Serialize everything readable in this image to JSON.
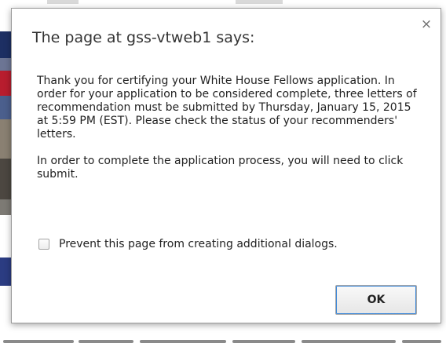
{
  "dialog": {
    "title": "The page at gss-vtweb1 says:",
    "close_glyph": "×",
    "message": {
      "paragraph_1": "Thank you for certifying your White House Fellows application. In order for your application to be considered complete, three letters of recommendation must be submitted by Thursday, January 15, 2015 at 5:59 PM (EST). Please check the status of your recommenders' letters.",
      "paragraph_2": "In order to complete the application process, you will need to click submit."
    },
    "checkbox": {
      "label": "Prevent this page from creating additional dialogs.",
      "checked": false
    },
    "ok_label": "OK"
  },
  "colors": {
    "dialog_border": "#9a9a9a",
    "focus_ring": "#3a86d8",
    "text": "#222222"
  },
  "icons": {
    "close": "close-icon"
  }
}
